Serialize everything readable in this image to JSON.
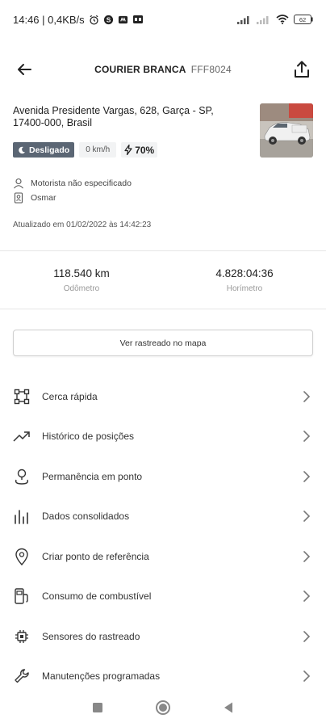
{
  "status_bar": {
    "time_speed": "14:46 | 0,4KB/s",
    "battery_level": "62"
  },
  "header": {
    "vehicle_name": "COURIER BRANCA",
    "plate": "FFF8024"
  },
  "vehicle": {
    "address": "Avenida Presidente Vargas, 628, Garça - SP, 17400-000, Brasil",
    "status_label": "Desligado",
    "speed": "0 km/h",
    "battery": "70%",
    "driver": "Motorista não especificado",
    "owner": "Osmar",
    "updated": "Atualizado em 01/02/2022 às 14:42:23"
  },
  "stats": {
    "odometer_value": "118.540 km",
    "odometer_label": "Odômetro",
    "hourmeter_value": "4.828:04:36",
    "hourmeter_label": "Horímetro"
  },
  "map_button": "Ver rastreado no mapa",
  "menu": [
    {
      "label": "Cerca rápida",
      "icon": "quick-fence-icon"
    },
    {
      "label": "Histórico de posições",
      "icon": "trending-icon"
    },
    {
      "label": "Permanência em ponto",
      "icon": "location-person-icon"
    },
    {
      "label": "Dados consolidados",
      "icon": "bar-chart-icon"
    },
    {
      "label": "Criar ponto de referência",
      "icon": "map-pin-icon"
    },
    {
      "label": "Consumo de combustível",
      "icon": "fuel-icon"
    },
    {
      "label": "Sensores do rastreado",
      "icon": "chip-icon"
    },
    {
      "label": "Manutenções programadas",
      "icon": "wrench-icon"
    }
  ]
}
